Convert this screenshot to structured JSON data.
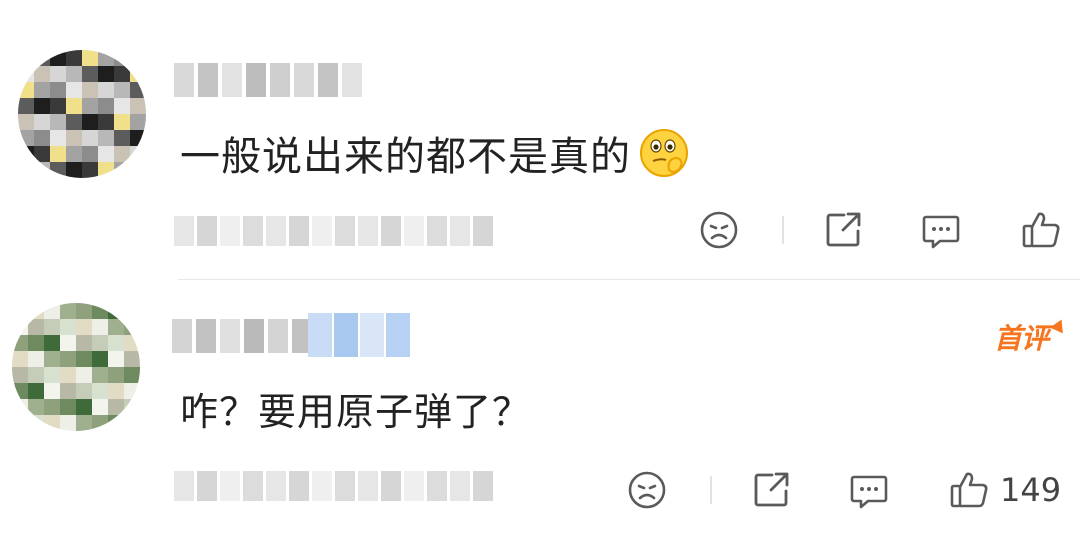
{
  "comments": [
    {
      "text": "一般说出来的都不是真的",
      "emoji": "thinking-face-emoji",
      "like_count": ""
    },
    {
      "text": "咋？要用原子弹了？",
      "badge_label": "首评",
      "like_count": "149"
    }
  ],
  "colors": {
    "accent": "#f7751e",
    "icon": "#5a5a5a",
    "text": "#222222",
    "divider": "#e8e8e8"
  },
  "icons": [
    "unhappy-face-icon",
    "share-icon",
    "comment-icon",
    "like-icon"
  ]
}
